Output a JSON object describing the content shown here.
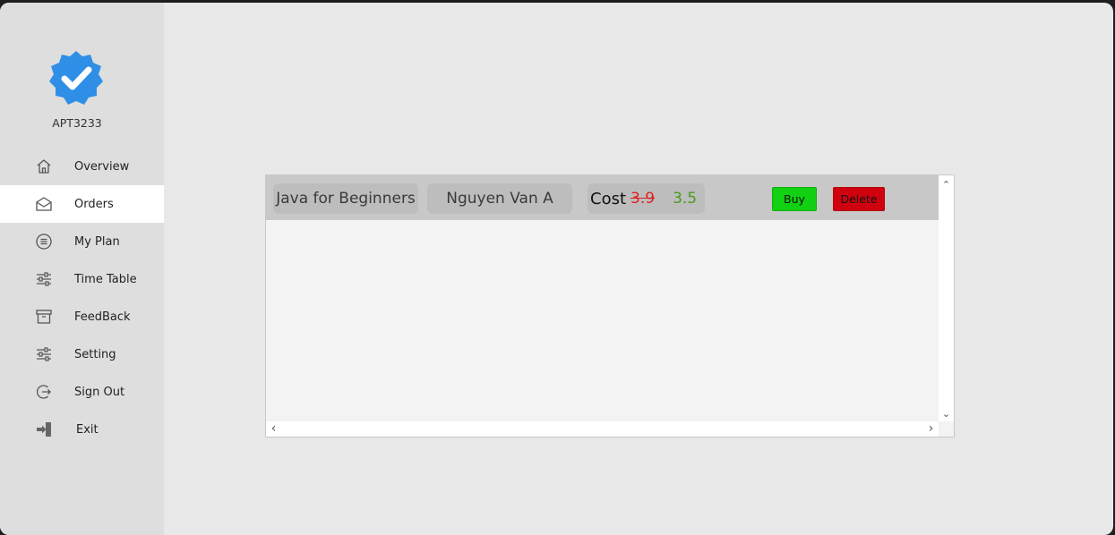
{
  "brand": {
    "name": "APT3233",
    "badge_color": "#2f8fe6"
  },
  "nav": {
    "items": [
      {
        "label": "Overview",
        "icon": "home-icon",
        "active": false
      },
      {
        "label": "Orders",
        "icon": "envelope-icon",
        "active": true
      },
      {
        "label": "My Plan",
        "icon": "list-circle-icon",
        "active": false
      },
      {
        "label": "Time Table",
        "icon": "sliders-icon",
        "active": false
      },
      {
        "label": "FeedBack",
        "icon": "archive-icon",
        "active": false
      },
      {
        "label": "Setting",
        "icon": "sliders-icon",
        "active": false
      },
      {
        "label": "Sign Out",
        "icon": "sign-out-icon",
        "active": false
      },
      {
        "label": "Exit",
        "icon": "exit-icon",
        "active": false
      }
    ]
  },
  "order": {
    "title": "Java for Beginners",
    "author": "Nguyen Van A",
    "cost_label": "Cost",
    "old_price": "3.9",
    "new_price": "3.5",
    "buy_label": "Buy",
    "delete_label": "Delete",
    "buy_color": "#12d012",
    "delete_color": "#d1000f"
  },
  "scroll": {
    "up": "⌃",
    "down": "⌄",
    "left": "‹",
    "right": "›"
  }
}
